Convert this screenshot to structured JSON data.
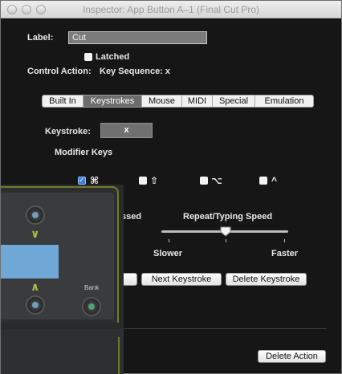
{
  "window": {
    "title": "Inspector: App Button A–1 (Final Cut Pro)"
  },
  "label_field": {
    "label": "Label:",
    "value": "Cut"
  },
  "latched": {
    "label": "Latched"
  },
  "control_action": {
    "label": "Control Action:",
    "value": "Key Sequence: x"
  },
  "tabs": [
    {
      "label": "Built In",
      "active": false
    },
    {
      "label": "Keystrokes",
      "active": true
    },
    {
      "label": "Mouse",
      "active": false
    },
    {
      "label": "MIDI",
      "active": false
    },
    {
      "label": "Special",
      "active": false
    },
    {
      "label": "Emulation",
      "active": false
    }
  ],
  "keystroke": {
    "label": "Keystroke:",
    "value": "x"
  },
  "modifier_keys": {
    "label": "Modifier Keys",
    "items": [
      {
        "glyph": "⌘",
        "checked": true,
        "icon": "command-icon"
      },
      {
        "glyph": "⇧",
        "checked": false,
        "icon": "shift-icon"
      },
      {
        "glyph": "⌥",
        "checked": false,
        "icon": "option-icon"
      },
      {
        "glyph": "^",
        "checked": false,
        "icon": "control-icon"
      }
    ]
  },
  "pressed_label": "ssed",
  "repeat_speed": {
    "label": "Repeat/Typing Speed",
    "slower": "Slower",
    "faster": "Faster",
    "value": 0.5
  },
  "buttons": {
    "next_keystroke": "Next Keystroke",
    "delete_keystroke": "Delete Keystroke",
    "delete_action": "Delete Action"
  },
  "panel": {
    "bank_label": "Bank"
  }
}
